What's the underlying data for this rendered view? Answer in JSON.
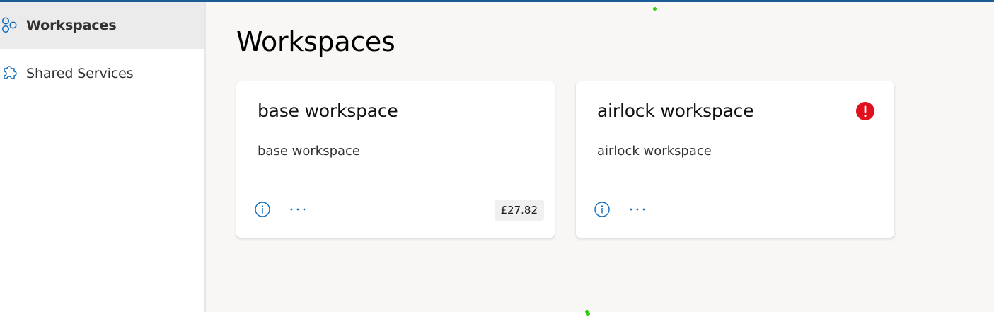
{
  "sidebar": {
    "items": [
      {
        "label": "Workspaces",
        "icon": "workspaces-icon",
        "active": true
      },
      {
        "label": "Shared Services",
        "icon": "puzzle-icon",
        "active": false
      }
    ]
  },
  "main": {
    "title": "Workspaces",
    "cards": [
      {
        "title": "base workspace",
        "description": "base workspace",
        "cost": "£27.82",
        "has_error": false
      },
      {
        "title": "airlock workspace",
        "description": "airlock workspace",
        "cost": "",
        "has_error": true
      }
    ]
  },
  "colors": {
    "accent": "#0f6cbd",
    "error": "#e0101e",
    "topbar": "#1b5c96"
  }
}
